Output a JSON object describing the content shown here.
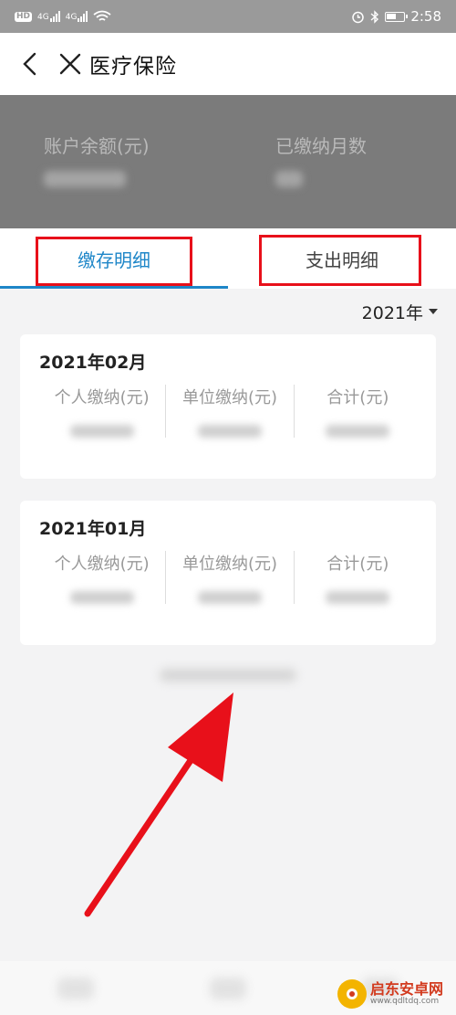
{
  "status_bar": {
    "hd_label": "HD",
    "net1": "4G",
    "net2": "4G",
    "time": "2:58"
  },
  "header": {
    "title": "医疗保险"
  },
  "summary": {
    "balance_label": "账户余额(元)",
    "months_label": "已缴纳月数"
  },
  "tabs": [
    {
      "label": "缴存明细",
      "active": true
    },
    {
      "label": "支出明细",
      "active": false
    }
  ],
  "year_filter": {
    "value": "2021年"
  },
  "records": [
    {
      "month": "2021年02月"
    },
    {
      "month": "2021年01月"
    }
  ],
  "columns": [
    "个人缴纳(元)",
    "单位缴纳(元)",
    "合计(元)"
  ],
  "watermark": {
    "name": "启东安卓网",
    "url": "www.qdltdq.com"
  },
  "colors": {
    "accent": "#1e86c8",
    "annotation_red": "#e8101a",
    "summary_bg": "#7b7b7b"
  }
}
